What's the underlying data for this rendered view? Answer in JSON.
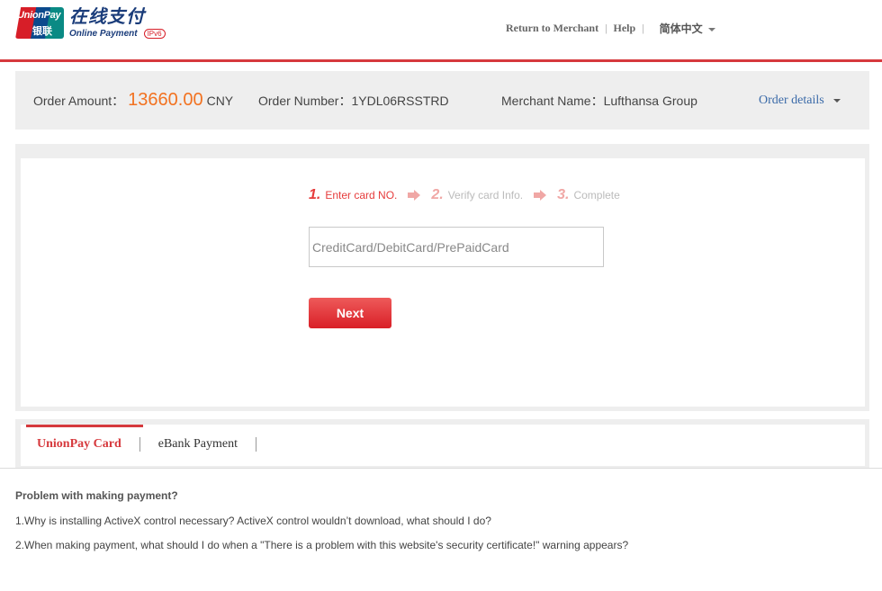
{
  "header": {
    "logo": {
      "badge_top": "UnionPay",
      "badge_bottom": "银联",
      "title_cn": "在线支付",
      "title_en": "Online Payment",
      "ipv6": "IPv6"
    },
    "links": {
      "return_to_merchant": "Return to Merchant",
      "separator": "|",
      "help": "Help",
      "language": "简体中文"
    }
  },
  "order": {
    "amount_label": "Order Amount：",
    "amount": "13660.00",
    "currency": "CNY",
    "number_label": "Order Number：",
    "number": "1YDL06RSSTRD",
    "merchant_label": "Merchant Name：",
    "merchant": "Lufthansa Group",
    "details_link": "Order details"
  },
  "steps": [
    {
      "num": "1.",
      "label": "Enter card NO.",
      "active": true
    },
    {
      "num": "2.",
      "label": "Verify card Info.",
      "active": false
    },
    {
      "num": "3.",
      "label": "Complete",
      "active": false
    }
  ],
  "card_form": {
    "placeholder": "CreditCard/DebitCard/PrePaidCard",
    "value": "",
    "next_label": "Next"
  },
  "tabs": [
    {
      "label": "UnionPay Card",
      "active": true
    },
    {
      "label": "eBank Payment",
      "active": false
    }
  ],
  "faq": {
    "title": "Problem with making payment?",
    "items": [
      "1.Why is installing ActiveX control necessary? ActiveX control wouldn’t download, what should I do?",
      "2.When making payment, what should I do when a \"There is a problem with this website's security certificate!\" warning appears?"
    ]
  },
  "colors": {
    "accent_red": "#d6393d",
    "amount_orange": "#f27220",
    "link_blue": "#3a6aa8",
    "panel_gray": "#eeeeee"
  }
}
